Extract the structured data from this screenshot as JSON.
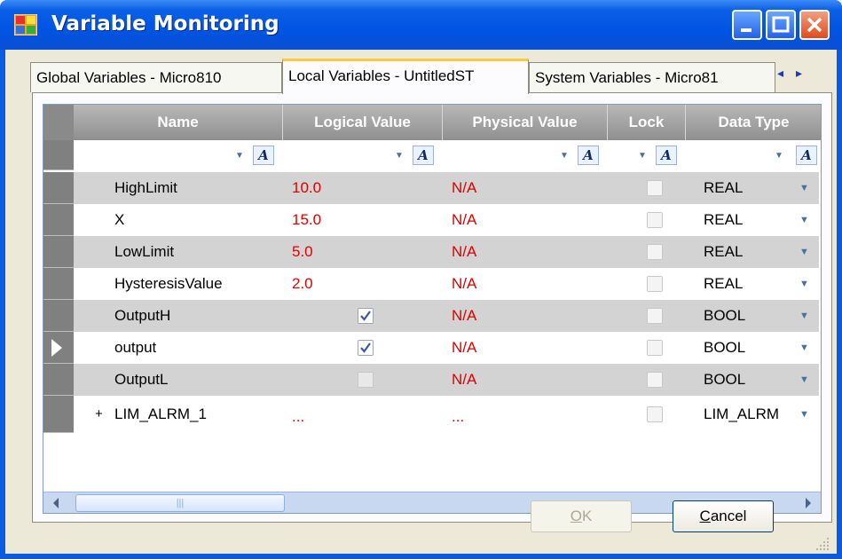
{
  "window": {
    "title": "Variable Monitoring",
    "colors": {
      "titlebar": "#0054e3",
      "value_red": "#e00000",
      "active_tab_accent": "#ffc83c"
    }
  },
  "tabs": [
    {
      "label": "Global Variables - Micro810",
      "active": false
    },
    {
      "label": "Local Variables - UntitledST",
      "active": true
    },
    {
      "label": "System Variables - Micro81",
      "active": false
    }
  ],
  "tab_scroll": {
    "left": "◂",
    "right": "▸"
  },
  "columns": [
    "Name",
    "Logical Value",
    "Physical Value",
    "Lock",
    "Data Type"
  ],
  "rows": [
    {
      "name": "HighLimit",
      "logical": "10.0",
      "physical": "N/A",
      "type": "REAL"
    },
    {
      "name": "X",
      "logical": "15.0",
      "physical": "N/A",
      "type": "REAL"
    },
    {
      "name": "LowLimit",
      "logical": "5.0",
      "physical": "N/A",
      "type": "REAL"
    },
    {
      "name": "HysteresisValue",
      "logical": "2.0",
      "physical": "N/A",
      "type": "REAL"
    },
    {
      "name": "OutputH",
      "logical_check": true,
      "physical": "N/A",
      "type": "BOOL"
    },
    {
      "name": "output",
      "logical_check": true,
      "physical": "N/A",
      "type": "BOOL"
    },
    {
      "name": "OutputL",
      "logical_check": false,
      "physical": "N/A",
      "type": "BOOL"
    },
    {
      "expander": "+",
      "name": "LIM_ALRM_1",
      "logical": "...",
      "physical": "...",
      "type": "LIM_ALRM"
    }
  ],
  "buttons": {
    "ok": "OK",
    "ok_access": "O",
    "ok_rest": "K",
    "cancel_access": "C",
    "cancel_rest": "ancel"
  }
}
